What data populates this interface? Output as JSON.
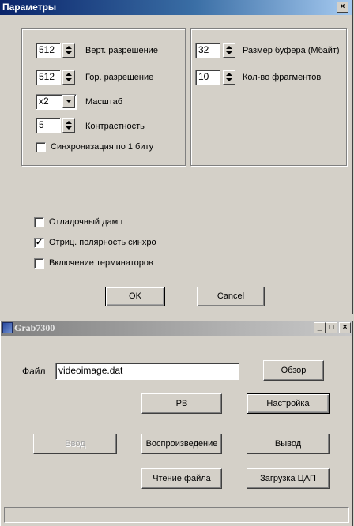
{
  "dialog": {
    "title": "Параметры",
    "close_label": "×",
    "vert_res": {
      "value": "512",
      "label": "Верт. разрешение"
    },
    "hor_res": {
      "value": "512",
      "label": "Гор. разрешение"
    },
    "scale": {
      "value": "x2",
      "label": "Масштаб"
    },
    "contrast": {
      "value": "5",
      "label": "Контрастность"
    },
    "sync_bit": {
      "label": "Синхронизация по 1 биту",
      "checked": false
    },
    "buffer_size": {
      "value": "32",
      "label": "Размер буфера (Мбайт)"
    },
    "fragments": {
      "value": "10",
      "label": "Кол-во фрагментов"
    },
    "debug_dump": {
      "label": "Отладочный дамп",
      "checked": false
    },
    "neg_sync": {
      "label": "Отриц. полярность синхро",
      "checked": true
    },
    "terminators": {
      "label": "Включение терминаторов",
      "checked": false
    },
    "ok_label": "OK",
    "cancel_label": "Cancel"
  },
  "app": {
    "title": "Grab7300",
    "min_label": "_",
    "max_label": "□",
    "close_label": "×",
    "file_label": "Файл",
    "file_value": "videoimage.dat",
    "browse_label": "Обзор",
    "pb_label": "PB",
    "settings_label": "Настройка",
    "input_label": "Ввод",
    "playback_label": "Воспроизведение",
    "output_label": "Вывод",
    "read_file_label": "Чтение файла",
    "dac_load_label": "Загрузка ЦАП"
  }
}
